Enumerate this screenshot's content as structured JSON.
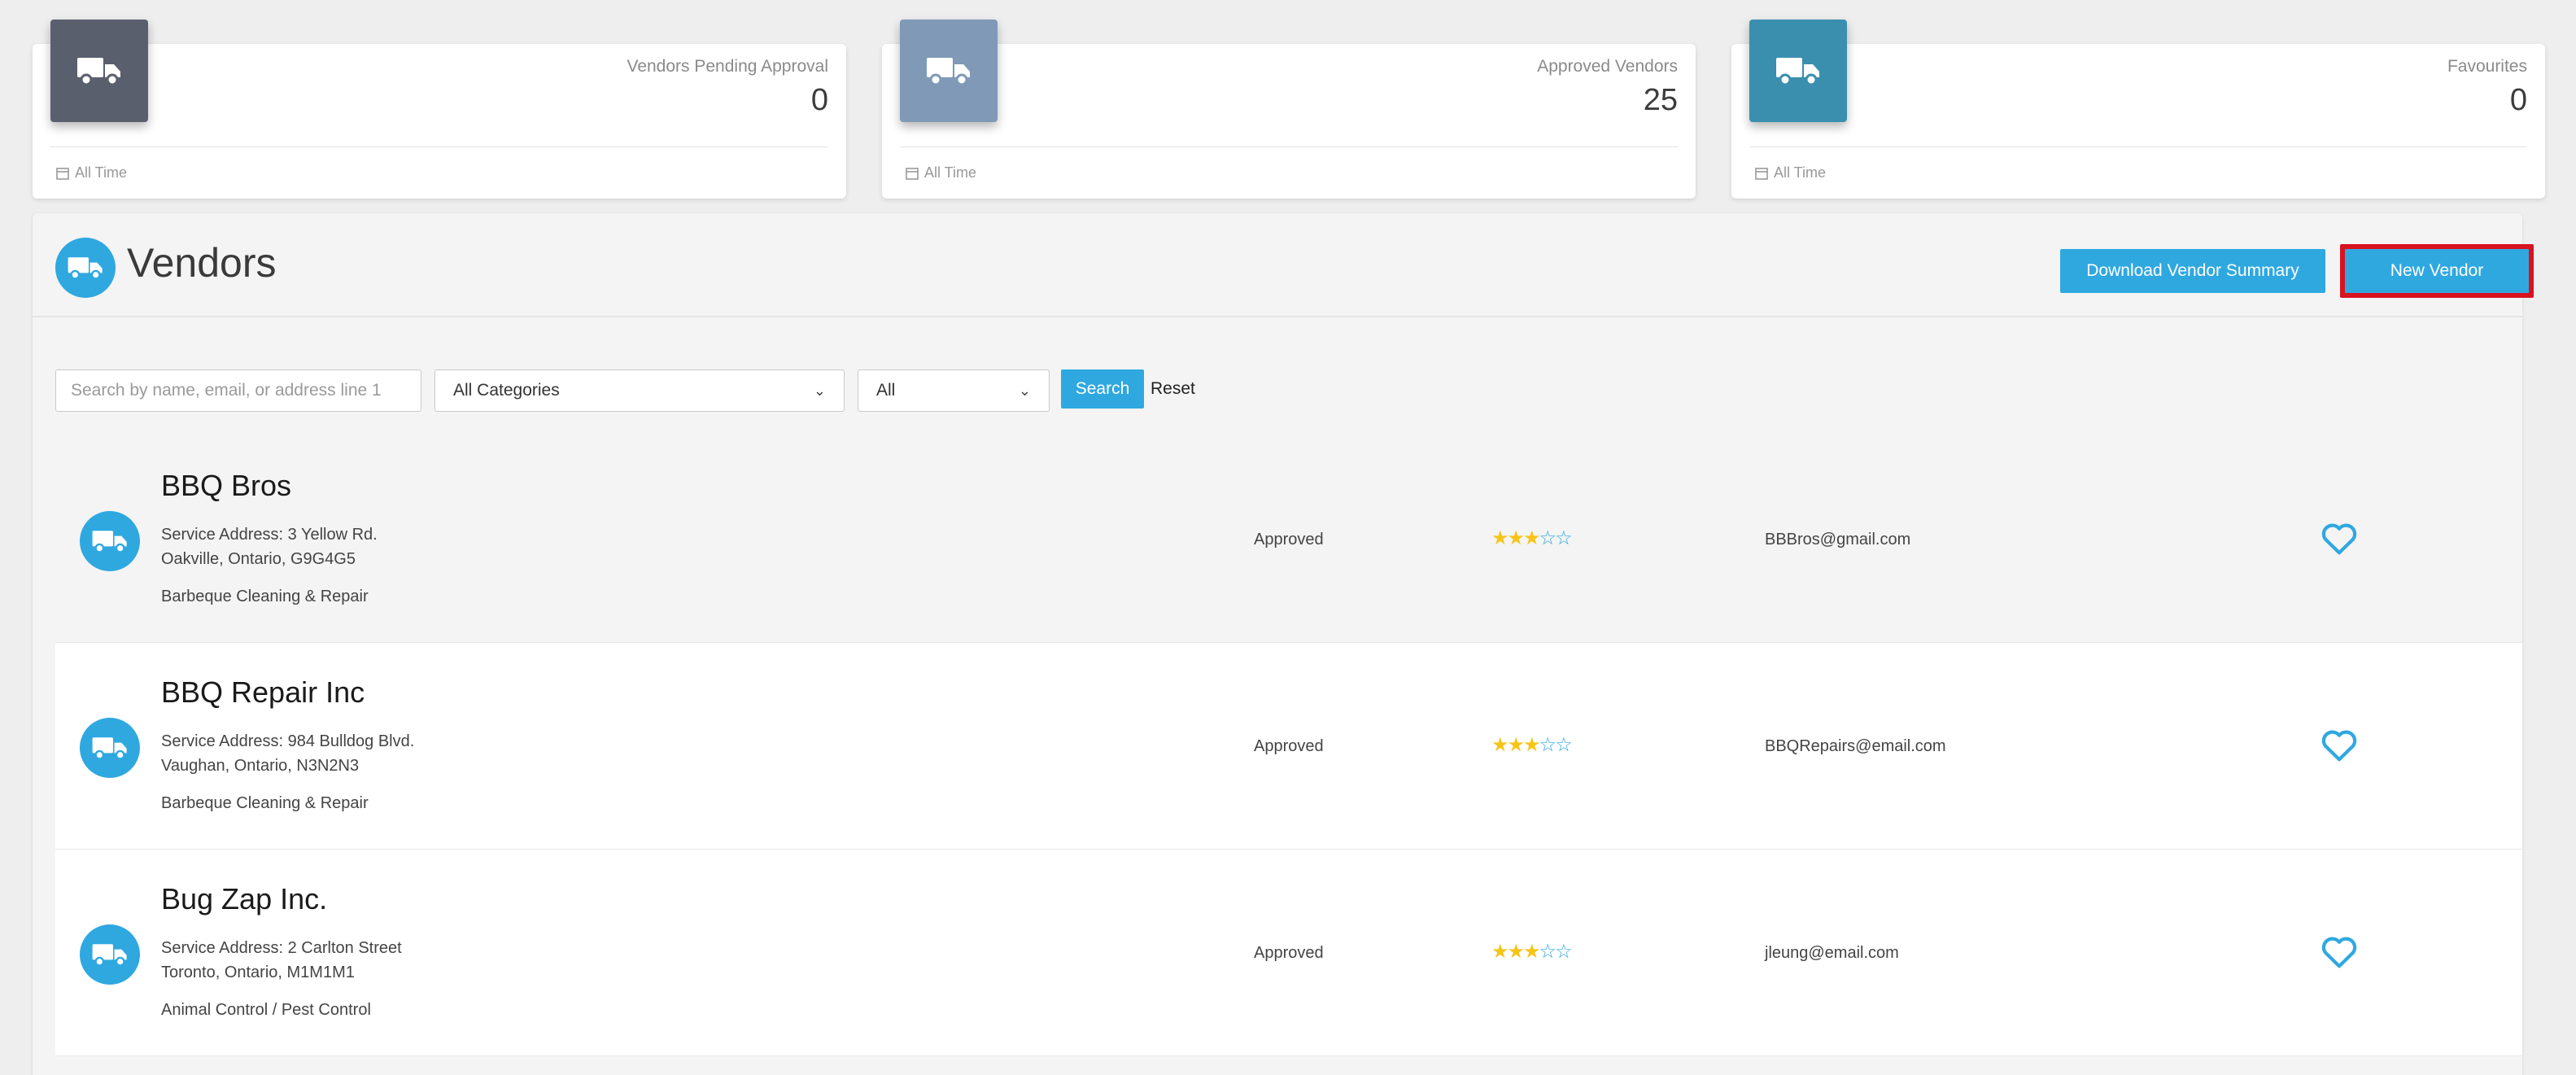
{
  "stats": [
    {
      "label": "Vendors Pending Approval",
      "value": "0",
      "footer": "All Time",
      "color": "#5a5f6e",
      "icon": "truck-icon"
    },
    {
      "label": "Approved Vendors",
      "value": "25",
      "footer": "All Time",
      "color": "#7f99b6",
      "icon": "truck-icon"
    },
    {
      "label": "Favourites",
      "value": "0",
      "footer": "All Time",
      "color": "#3a8fae",
      "icon": "truck-icon"
    }
  ],
  "header": {
    "title": "Vendors",
    "download_label": "Download Vendor Summary",
    "new_label": "New Vendor"
  },
  "filters": {
    "search_placeholder": "Search by name, email, or address line 1",
    "search_value": "",
    "category_selected": "All Categories",
    "status_selected": "All",
    "search_label": "Search",
    "reset_label": "Reset"
  },
  "accent_color": "#2fa8e0",
  "highlight_color": "#d9121f",
  "vendors": [
    {
      "name": "BBQ Bros",
      "address_line1": "Service Address: 3 Yellow Rd.",
      "address_line2": "Oakville, Ontario, G9G4G5",
      "category": "Barbeque Cleaning & Repair",
      "status": "Approved",
      "rating": 3,
      "rating_max": 5,
      "email": "BBBros@gmail.com"
    },
    {
      "name": "BBQ Repair Inc",
      "address_line1": "Service Address: 984 Bulldog Blvd.",
      "address_line2": "Vaughan, Ontario, N3N2N3",
      "category": "Barbeque Cleaning & Repair",
      "status": "Approved",
      "rating": 3,
      "rating_max": 5,
      "email": "BBQRepairs@email.com"
    },
    {
      "name": "Bug Zap Inc.",
      "address_line1": "Service Address: 2 Carlton Street",
      "address_line2": "Toronto, Ontario, M1M1M1",
      "category": "Animal Control / Pest Control",
      "status": "Approved",
      "rating": 3,
      "rating_max": 5,
      "email": "jleung@email.com"
    }
  ]
}
